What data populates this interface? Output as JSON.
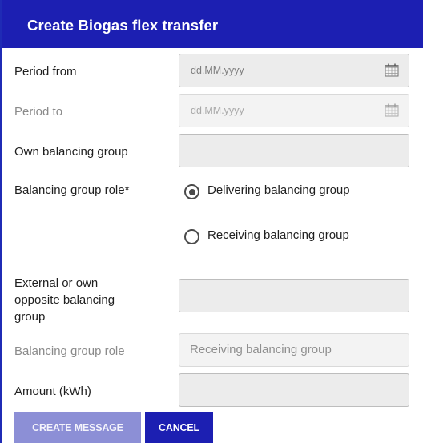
{
  "dialog": {
    "title": "Create Biogas flex transfer",
    "colors": {
      "header": "#1c1fb2",
      "primary_button": "#1c1fb2",
      "disabled_button": "#8c8fd6"
    }
  },
  "form": {
    "period_from": {
      "label": "Period from",
      "placeholder": "dd.MM.yyyy",
      "icon": "calendar-icon"
    },
    "period_to": {
      "label": "Period to",
      "placeholder": "dd.MM.yyyy",
      "icon": "calendar-icon"
    },
    "own_balancing_group": {
      "label": "Own balancing group",
      "value": ""
    },
    "balancing_group_role": {
      "label": "Balancing group role*",
      "options": [
        {
          "label": "Delivering balancing group",
          "selected": true
        },
        {
          "label": "Receiving balancing group",
          "selected": false
        }
      ]
    },
    "opposite_group": {
      "label_line1": "External or own",
      "label_line2": "opposite balancing",
      "label_line3": "group",
      "value": ""
    },
    "opposite_role": {
      "label": "Balancing group role",
      "value": "Receiving balancing group"
    },
    "amount": {
      "label": "Amount (kWh)",
      "value": ""
    }
  },
  "buttons": {
    "create_label": "CREATE MESSAGE",
    "cancel_label": "CANCEL"
  }
}
